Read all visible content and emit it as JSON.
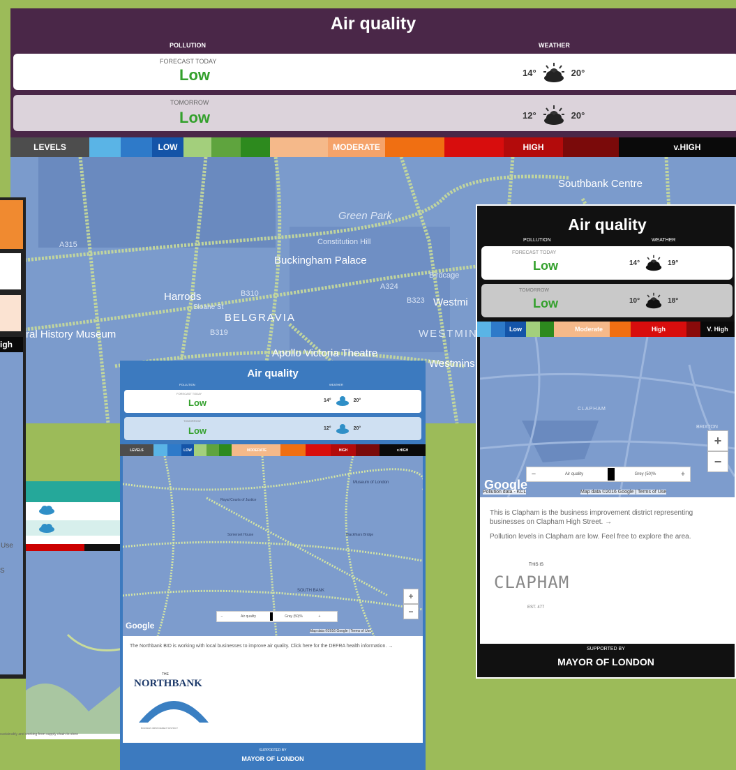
{
  "main": {
    "title": "Air quality",
    "pollution_header": "POLLUTION",
    "weather_header": "WEATHER",
    "today_label": "FORECAST TODAY",
    "today_value": "Low",
    "today_low": "14°",
    "today_high": "20°",
    "tomorrow_label": "TOMORROW",
    "tomorrow_value": "Low",
    "tomorrow_low": "12°",
    "tomorrow_high": "20°",
    "levels": [
      "LEVELS",
      "LOW",
      "MODERATE",
      "HIGH",
      "v.HIGH"
    ],
    "map_labels": [
      "Green Park",
      "Southbank Centre",
      "Buckingham Palace",
      "Constitution Hill",
      "Harrods",
      "B310",
      "BELGRAVIA",
      "B319",
      "B323",
      "Westmi",
      "WESTMINS",
      "ral History Museum",
      "Apollo Victoria Theatre",
      "Westmins",
      "Birdcage",
      "A324",
      "A315",
      "Sloane St"
    ],
    "colors": {
      "header": "#4a2748",
      "tomorrow_bg": "#dcd3db",
      "low_text": "#33a02c"
    }
  },
  "left_partial": {
    "fragment_text": "igh",
    "use_text": "Use",
    "s_text": "S"
  },
  "teal_partial": {
    "header_color": "#25a89a"
  },
  "northbank": {
    "title": "Air quality",
    "pollution_header": "POLLUTION",
    "weather_header": "WEATHER",
    "today_label": "FORECAST TODAY",
    "today_value": "Low",
    "today_low": "14°",
    "today_high": "20°",
    "tomorrow_label": "TOMORROW",
    "tomorrow_value": "Low",
    "tomorrow_low": "12°",
    "tomorrow_high": "20°",
    "levels": [
      "LEVELS",
      "LOW",
      "MODERATE",
      "HIGH",
      "v.HIGH"
    ],
    "map_labels": [
      "Google",
      "Royal Courts of Justice",
      "Somerset House",
      "Museum of London",
      "Blackfriars Bridge",
      "SOUTH BANK"
    ],
    "slider_left": "Air quality",
    "slider_right": "Gray (50)%",
    "attribution": "Map data ©2016 Google | Terms of Use",
    "description": "The Northbank BID is working with local businesses to improve air quality. Click here for the DEFRA health information. →",
    "logo_the": "THE",
    "logo_name": "NORTHBANK",
    "logo_sub": "BUSINESS IMPROVEMENT DISTRICT",
    "supported_by": "SUPPORTED BY",
    "mayor": "MAYOR OF LONDON",
    "bottom_left_text": "sustainably and working from supply chain to store",
    "colors": {
      "header": "#3c7abf"
    }
  },
  "clapham": {
    "title": "Air quality",
    "pollution_header": "POLLUTION",
    "weather_header": "WEATHER",
    "today_label": "FORECAST TODAY",
    "today_value": "Low",
    "today_low": "14°",
    "today_high": "19°",
    "tomorrow_label": "TOMORROW",
    "tomorrow_value": "Low",
    "tomorrow_low": "10°",
    "tomorrow_high": "18°",
    "levels": [
      "Low",
      "Moderate",
      "High",
      "V. High"
    ],
    "map_labels": [
      "CLAPHAM",
      "BRIXTON",
      "Google"
    ],
    "slider_left": "Air quality",
    "slider_right": "Grey (50)%",
    "pollution_data": "Pollution data - KCL",
    "attribution": "Map data ©2016 Google | Terms of Use",
    "description": "This is Clapham is the business improvement district representing businesses on Clapham High Street. →",
    "levels_text": "Pollution levels in Clapham are low. Feel free to explore the area.",
    "logo_this_is": "THIS IS",
    "logo_name": "CLAPHAM",
    "logo_est": "EST. 477",
    "supported_by": "SUPPORTED BY",
    "mayor": "MAYOR OF LONDON",
    "colors": {
      "header": "#111111"
    }
  }
}
